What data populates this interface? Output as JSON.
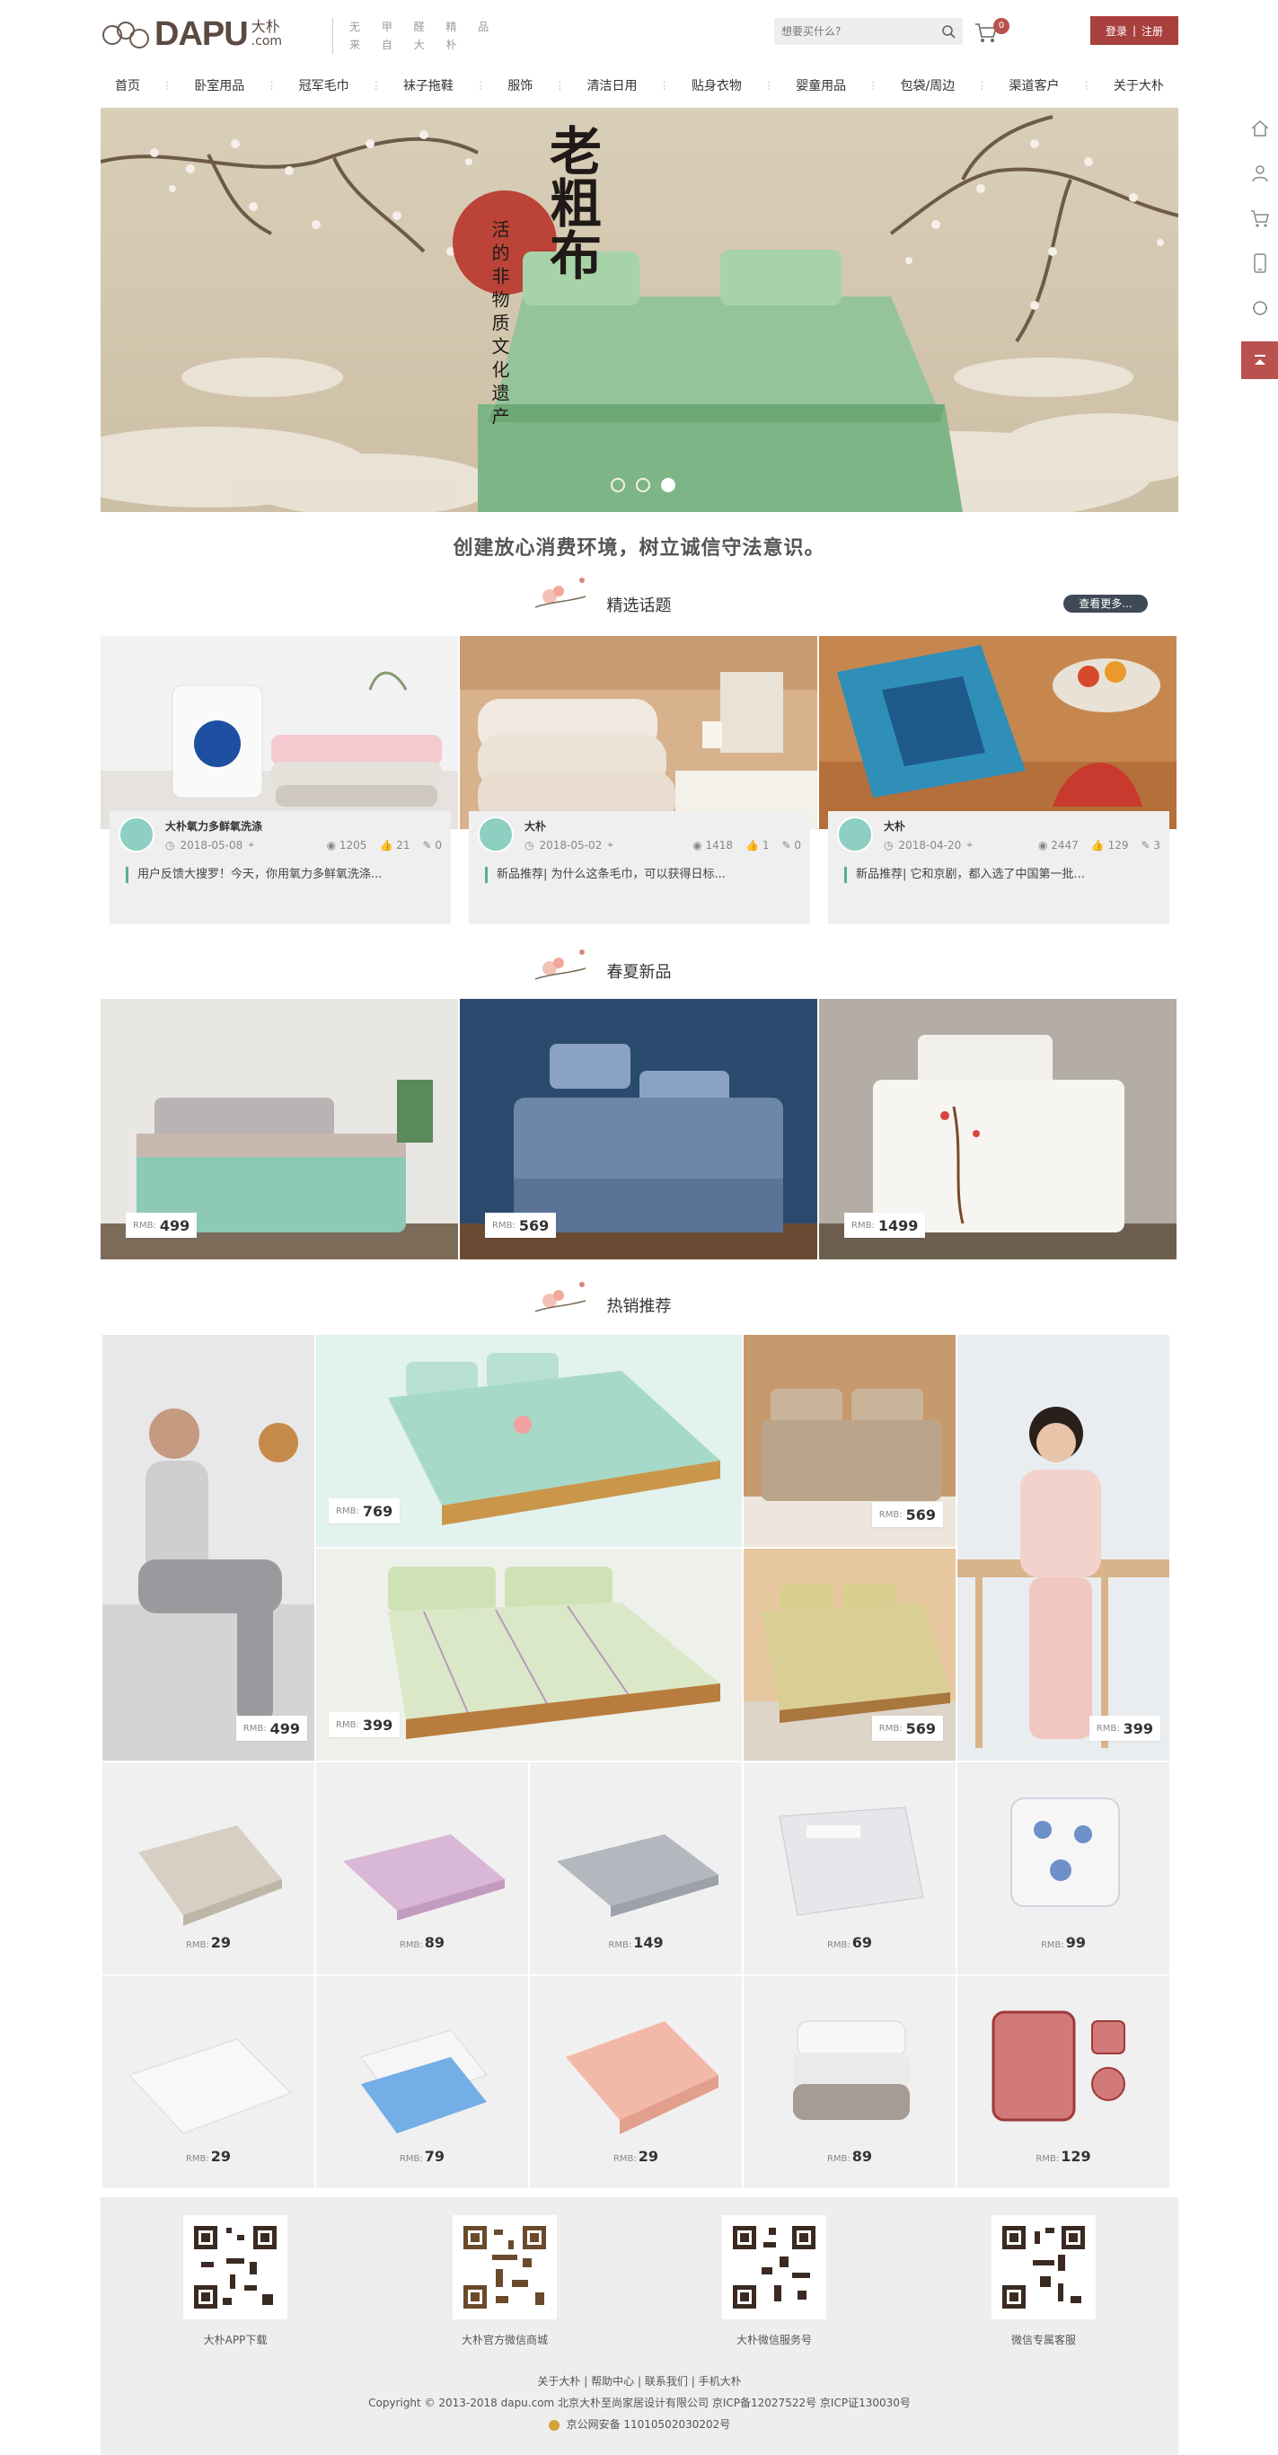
{
  "header": {
    "logo_text": "DAPU",
    "logo_cn": "大朴",
    "logo_domain": ".com",
    "slogan_line1": "无 甲 醛 精 品",
    "slogan_line2": "来 自 大 朴",
    "search_placeholder": "想要买什么?",
    "cart_count": "0",
    "login": "登录",
    "divider": "|",
    "register": "注册"
  },
  "nav": [
    "首页",
    "卧室用品",
    "冠军毛巾",
    "袜子拖鞋",
    "服饰",
    "清洁日用",
    "贴身衣物",
    "婴童用品",
    "包袋/周边",
    "渠道客户",
    "关于大朴"
  ],
  "banner": {
    "title": "老粗布",
    "subtitle": "活的非物质文化遗产",
    "active_slide": 3,
    "slide_count": 3
  },
  "tagline": "创建放心消费环境，树立诚信守法意识。",
  "sections": {
    "topics_title": "精选话题",
    "more_label": "查看更多...",
    "spring_title": "春夏新品",
    "hot_title": "热销推荐"
  },
  "topics": [
    {
      "author": "大朴氧力多鲜氧洗涤",
      "date": "2018-05-08",
      "views": "1205",
      "likes": "21",
      "comments": "0",
      "excerpt": "用户反馈大搜罗！今天，你用氧力多鲜氧洗涤..."
    },
    {
      "author": "大朴",
      "date": "2018-05-02",
      "views": "1418",
      "likes": "1",
      "comments": "0",
      "excerpt": "新品推荐| 为什么这条毛巾，可以获得日标..."
    },
    {
      "author": "大朴",
      "date": "2018-04-20",
      "views": "2447",
      "likes": "129",
      "comments": "3",
      "excerpt": "新品推荐| 它和京剧，都入选了中国第一批..."
    }
  ],
  "currency": "RMB:",
  "spring_items": [
    {
      "price": "499"
    },
    {
      "price": "569"
    },
    {
      "price": "1499"
    }
  ],
  "hot_items": [
    {
      "price": "499"
    },
    {
      "price": "769"
    },
    {
      "price": "569"
    },
    {
      "price": "399"
    },
    {
      "price": "399"
    },
    {
      "price": "569"
    }
  ],
  "small_items": [
    {
      "price": "29"
    },
    {
      "price": "89"
    },
    {
      "price": "149"
    },
    {
      "price": "69"
    },
    {
      "price": "99"
    },
    {
      "price": "29"
    },
    {
      "price": "79"
    },
    {
      "price": "29"
    },
    {
      "price": "89"
    },
    {
      "price": "129"
    }
  ],
  "footer": {
    "qr_labels": [
      "大朴APP下载",
      "大朴官方微信商城",
      "大朴微信服务号",
      "微信专属客服"
    ],
    "links": [
      "关于大朴",
      "帮助中心",
      "联系我们",
      "手机大朴"
    ],
    "link_sep": "|",
    "copyright": "Copyright © 2013-2018 dapu.com 北京大朴至尚家居设计有限公司 京ICP备12027522号 京ICP证130030号",
    "icp": "京公网安备 11010502030202号"
  },
  "colors": {
    "accent": "#a8403d",
    "topic_bar": "#5aae8e",
    "avatar": "#8dcfc1",
    "more_btn": "#3f4a56"
  },
  "float_icons": [
    "home-icon",
    "user-icon",
    "cart-icon",
    "phone-icon",
    "service-icon",
    "back-to-top-icon"
  ]
}
